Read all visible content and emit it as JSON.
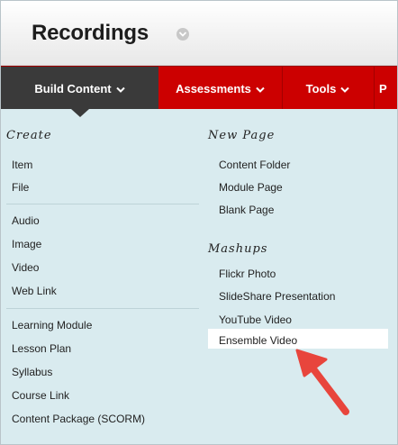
{
  "header": {
    "title": "Recordings"
  },
  "nav": {
    "tabs": [
      {
        "label": "Build Content"
      },
      {
        "label": "Assessments"
      },
      {
        "label": "Tools"
      },
      {
        "label": "P"
      }
    ]
  },
  "menu": {
    "create_heading": "Create",
    "create_group1": [
      "Item",
      "File"
    ],
    "create_group2": [
      "Audio",
      "Image",
      "Video",
      "Web Link"
    ],
    "create_group3": [
      "Learning Module",
      "Lesson Plan",
      "Syllabus",
      "Course Link",
      "Content Package (SCORM)"
    ],
    "newpage_heading": "New Page",
    "newpage_items": [
      "Content Folder",
      "Module Page",
      "Blank Page"
    ],
    "mashups_heading": "Mashups",
    "mashups_items": [
      "Flickr Photo",
      "SlideShare Presentation",
      "YouTube Video",
      "Ensemble Video"
    ]
  },
  "colors": {
    "nav_red": "#cc0000",
    "active_tab": "#3a3a3a",
    "panel_bg": "#d9ebef",
    "callout_arrow": "#e8453c"
  },
  "icons": {
    "title_menu": "chevron-down-circle-icon",
    "tab_chevron": "chevron-down-icon",
    "callout": "red-arrow-icon"
  }
}
